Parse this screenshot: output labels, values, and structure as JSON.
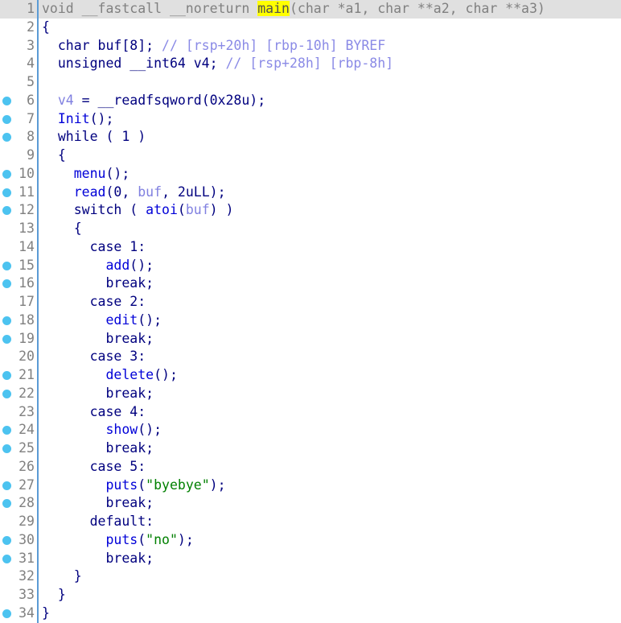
{
  "app": {
    "name": "IDA Pro Hex-Rays Decompiler",
    "view": "Pseudocode-A"
  },
  "theme": {
    "background": "#ffffff",
    "current_line_highlight": "#e0e0e0",
    "identifier_highlight": "#ffff00",
    "gutter_dot": "#4cc3f0",
    "separator": "#5b9bd5",
    "line_number": "#808080",
    "keyword": "#00007f",
    "function": "#0000d8",
    "variable": "#8080e0",
    "comment": "#8a8ae6",
    "string": "#008000"
  },
  "highlighted_identifier": "main",
  "lines": [
    {
      "number": "1",
      "dot": false,
      "current": true,
      "tokens": [
        {
          "text": "void __fastcall __noreturn ",
          "cls": "t-dim"
        },
        {
          "text": "main",
          "cls": "t-hl-dim"
        },
        {
          "text": "(char *a1, char **a2, char **a3)",
          "cls": "t-dim"
        }
      ],
      "plain": "void __fastcall __noreturn main(char *a1, char **a2, char **a3)"
    },
    {
      "number": "2",
      "dot": false,
      "current": false,
      "tokens": [
        {
          "text": "{",
          "cls": "t-kw"
        }
      ],
      "plain": "{"
    },
    {
      "number": "3",
      "dot": false,
      "current": false,
      "tokens": [
        {
          "text": "  char buf[8]; ",
          "cls": "t-kw"
        },
        {
          "text": "// [rsp+20h] [rbp-10h] BYREF",
          "cls": "t-comment"
        }
      ],
      "plain": "  char buf[8]; // [rsp+20h] [rbp-10h] BYREF"
    },
    {
      "number": "4",
      "dot": false,
      "current": false,
      "tokens": [
        {
          "text": "  unsigned __int64 v4; ",
          "cls": "t-kw"
        },
        {
          "text": "// [rsp+28h] [rbp-8h]",
          "cls": "t-comment"
        }
      ],
      "plain": "  unsigned __int64 v4; // [rsp+28h] [rbp-8h]"
    },
    {
      "number": "5",
      "dot": false,
      "current": false,
      "tokens": [],
      "plain": ""
    },
    {
      "number": "6",
      "dot": true,
      "current": false,
      "tokens": [
        {
          "text": "  ",
          "cls": "t-kw"
        },
        {
          "text": "v4",
          "cls": "t-var"
        },
        {
          "text": " = __readfsqword(0x28u);",
          "cls": "t-kw"
        }
      ],
      "plain": "  v4 = __readfsqword(0x28u);"
    },
    {
      "number": "7",
      "dot": true,
      "current": false,
      "tokens": [
        {
          "text": "  ",
          "cls": "t-kw"
        },
        {
          "text": "Init",
          "cls": "t-fn"
        },
        {
          "text": "();",
          "cls": "t-kw"
        }
      ],
      "plain": "  Init();"
    },
    {
      "number": "8",
      "dot": true,
      "current": false,
      "tokens": [
        {
          "text": "  while ( 1 )",
          "cls": "t-kw"
        }
      ],
      "plain": "  while ( 1 )"
    },
    {
      "number": "9",
      "dot": false,
      "current": false,
      "tokens": [
        {
          "text": "  {",
          "cls": "t-kw"
        }
      ],
      "plain": "  {"
    },
    {
      "number": "10",
      "dot": true,
      "current": false,
      "tokens": [
        {
          "text": "    ",
          "cls": "t-kw"
        },
        {
          "text": "menu",
          "cls": "t-fn"
        },
        {
          "text": "();",
          "cls": "t-kw"
        }
      ],
      "plain": "    menu();"
    },
    {
      "number": "11",
      "dot": true,
      "current": false,
      "tokens": [
        {
          "text": "    ",
          "cls": "t-kw"
        },
        {
          "text": "read",
          "cls": "t-fn"
        },
        {
          "text": "(0, ",
          "cls": "t-kw"
        },
        {
          "text": "buf",
          "cls": "t-var"
        },
        {
          "text": ", 2uLL);",
          "cls": "t-kw"
        }
      ],
      "plain": "    read(0, buf, 2uLL);"
    },
    {
      "number": "12",
      "dot": true,
      "current": false,
      "tokens": [
        {
          "text": "    switch ( ",
          "cls": "t-kw"
        },
        {
          "text": "atoi",
          "cls": "t-fn"
        },
        {
          "text": "(",
          "cls": "t-kw"
        },
        {
          "text": "buf",
          "cls": "t-var"
        },
        {
          "text": ") )",
          "cls": "t-kw"
        }
      ],
      "plain": "    switch ( atoi(buf) )"
    },
    {
      "number": "13",
      "dot": false,
      "current": false,
      "tokens": [
        {
          "text": "    {",
          "cls": "t-kw"
        }
      ],
      "plain": "    {"
    },
    {
      "number": "14",
      "dot": false,
      "current": false,
      "tokens": [
        {
          "text": "      case 1:",
          "cls": "t-kw"
        }
      ],
      "plain": "      case 1:"
    },
    {
      "number": "15",
      "dot": true,
      "current": false,
      "tokens": [
        {
          "text": "        ",
          "cls": "t-kw"
        },
        {
          "text": "add",
          "cls": "t-fn"
        },
        {
          "text": "();",
          "cls": "t-kw"
        }
      ],
      "plain": "        add();"
    },
    {
      "number": "16",
      "dot": true,
      "current": false,
      "tokens": [
        {
          "text": "        break;",
          "cls": "t-kw"
        }
      ],
      "plain": "        break;"
    },
    {
      "number": "17",
      "dot": false,
      "current": false,
      "tokens": [
        {
          "text": "      case 2:",
          "cls": "t-kw"
        }
      ],
      "plain": "      case 2:"
    },
    {
      "number": "18",
      "dot": true,
      "current": false,
      "tokens": [
        {
          "text": "        ",
          "cls": "t-kw"
        },
        {
          "text": "edit",
          "cls": "t-fn"
        },
        {
          "text": "();",
          "cls": "t-kw"
        }
      ],
      "plain": "        edit();"
    },
    {
      "number": "19",
      "dot": true,
      "current": false,
      "tokens": [
        {
          "text": "        break;",
          "cls": "t-kw"
        }
      ],
      "plain": "        break;"
    },
    {
      "number": "20",
      "dot": false,
      "current": false,
      "tokens": [
        {
          "text": "      case 3:",
          "cls": "t-kw"
        }
      ],
      "plain": "      case 3:"
    },
    {
      "number": "21",
      "dot": true,
      "current": false,
      "tokens": [
        {
          "text": "        ",
          "cls": "t-kw"
        },
        {
          "text": "delete",
          "cls": "t-fn"
        },
        {
          "text": "();",
          "cls": "t-kw"
        }
      ],
      "plain": "        delete();"
    },
    {
      "number": "22",
      "dot": true,
      "current": false,
      "tokens": [
        {
          "text": "        break;",
          "cls": "t-kw"
        }
      ],
      "plain": "        break;"
    },
    {
      "number": "23",
      "dot": false,
      "current": false,
      "tokens": [
        {
          "text": "      case 4:",
          "cls": "t-kw"
        }
      ],
      "plain": "      case 4:"
    },
    {
      "number": "24",
      "dot": true,
      "current": false,
      "tokens": [
        {
          "text": "        ",
          "cls": "t-kw"
        },
        {
          "text": "show",
          "cls": "t-fn"
        },
        {
          "text": "();",
          "cls": "t-kw"
        }
      ],
      "plain": "        show();"
    },
    {
      "number": "25",
      "dot": true,
      "current": false,
      "tokens": [
        {
          "text": "        break;",
          "cls": "t-kw"
        }
      ],
      "plain": "        break;"
    },
    {
      "number": "26",
      "dot": false,
      "current": false,
      "tokens": [
        {
          "text": "      case 5:",
          "cls": "t-kw"
        }
      ],
      "plain": "      case 5:"
    },
    {
      "number": "27",
      "dot": true,
      "current": false,
      "tokens": [
        {
          "text": "        ",
          "cls": "t-kw"
        },
        {
          "text": "puts",
          "cls": "t-fn"
        },
        {
          "text": "(",
          "cls": "t-kw"
        },
        {
          "text": "\"byebye\"",
          "cls": "t-str"
        },
        {
          "text": ");",
          "cls": "t-kw"
        }
      ],
      "plain": "        puts(\"byebye\");"
    },
    {
      "number": "28",
      "dot": true,
      "current": false,
      "tokens": [
        {
          "text": "        break;",
          "cls": "t-kw"
        }
      ],
      "plain": "        break;"
    },
    {
      "number": "29",
      "dot": false,
      "current": false,
      "tokens": [
        {
          "text": "      default:",
          "cls": "t-kw"
        }
      ],
      "plain": "      default:"
    },
    {
      "number": "30",
      "dot": true,
      "current": false,
      "tokens": [
        {
          "text": "        ",
          "cls": "t-kw"
        },
        {
          "text": "puts",
          "cls": "t-fn"
        },
        {
          "text": "(",
          "cls": "t-kw"
        },
        {
          "text": "\"no\"",
          "cls": "t-str"
        },
        {
          "text": ");",
          "cls": "t-kw"
        }
      ],
      "plain": "        puts(\"no\");"
    },
    {
      "number": "31",
      "dot": true,
      "current": false,
      "tokens": [
        {
          "text": "        break;",
          "cls": "t-kw"
        }
      ],
      "plain": "        break;"
    },
    {
      "number": "32",
      "dot": false,
      "current": false,
      "tokens": [
        {
          "text": "    }",
          "cls": "t-kw"
        }
      ],
      "plain": "    }"
    },
    {
      "number": "33",
      "dot": false,
      "current": false,
      "tokens": [
        {
          "text": "  }",
          "cls": "t-kw"
        }
      ],
      "plain": "  }"
    },
    {
      "number": "34",
      "dot": true,
      "current": false,
      "tokens": [
        {
          "text": "}",
          "cls": "t-kw"
        }
      ],
      "plain": "}"
    }
  ]
}
